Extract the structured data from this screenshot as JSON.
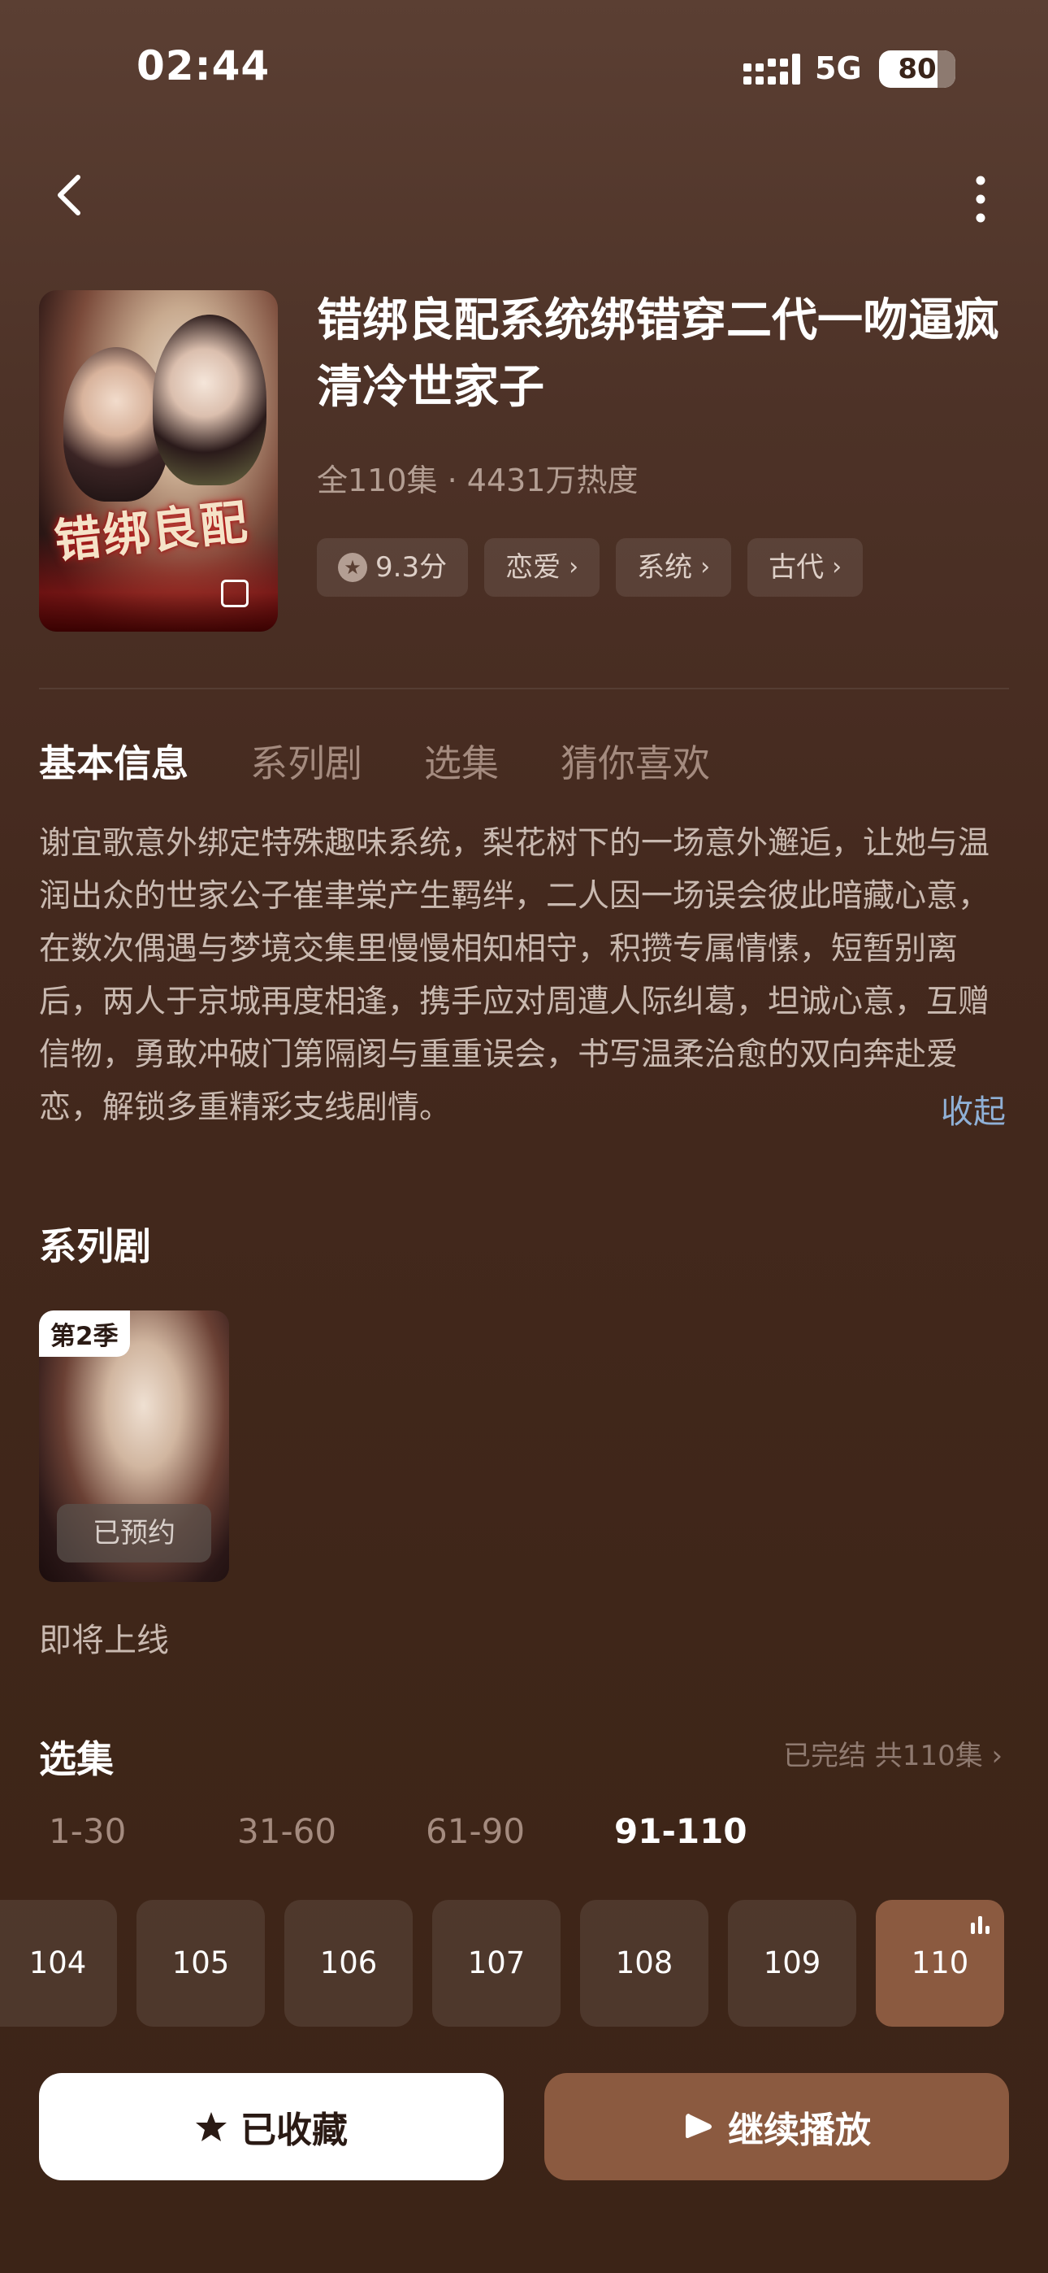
{
  "status_bar": {
    "time": "02:44",
    "network": "5G",
    "battery": "80"
  },
  "drama": {
    "title": "错绑良配系统绑错穿二代一吻逼疯清冷世家子",
    "meta": "全110集 · 4431万热度",
    "cover_title": "错绑良配",
    "rating": "9.3分",
    "tags": [
      "恋爱",
      "系统",
      "古代"
    ]
  },
  "tabs": [
    "基本信息",
    "系列剧",
    "选集",
    "猜你喜欢"
  ],
  "description": "谢宜歌意外绑定特殊趣味系统，梨花树下的一场意外邂逅，让她与温润出众的世家公子崔聿棠产生羁绊，二人因一场误会彼此暗藏心意，在数次偶遇与梦境交集里慢慢相知相守，积攒专属情愫，短暂别离后，两人于京城再度相逢，携手应对周遭人际纠葛，坦诚心意，互赠信物，勇敢冲破门第隔阂与重重误会，书写温柔治愈的双向奔赴爱恋，解锁多重精彩支线剧情。",
  "collapse_label": "收起",
  "series": {
    "section_title": "系列剧",
    "season": "第2季",
    "reserve_label": "已预约",
    "status": "即将上线"
  },
  "episodes": {
    "section_title": "选集",
    "summary": "已完结 共110集",
    "ranges": [
      "1-30",
      "31-60",
      "61-90",
      "91-110"
    ],
    "active_range": 3,
    "items": [
      "104",
      "105",
      "106",
      "107",
      "108",
      "109",
      "110"
    ],
    "current": "110"
  },
  "actions": {
    "favorite": "已收藏",
    "play": "继续播放"
  },
  "colors": {
    "accent": "#8b5a40",
    "link": "#8fb0d6",
    "background": "#44291e"
  }
}
